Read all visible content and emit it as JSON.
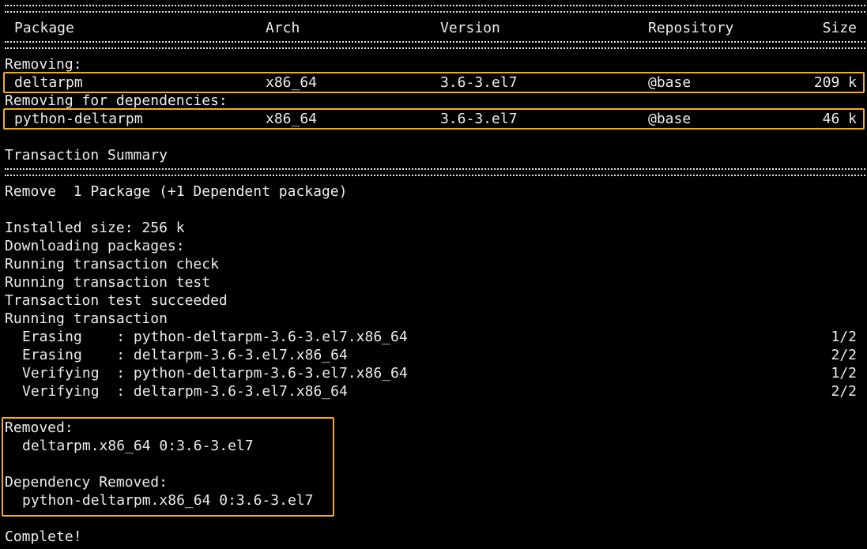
{
  "table": {
    "headers": {
      "package": "Package",
      "arch": "Arch",
      "version": "Version",
      "repository": "Repository",
      "size": "Size"
    },
    "removing_label": "Removing:",
    "removing_deps_label": "Removing for dependencies:",
    "rows": [
      {
        "package": "deltarpm",
        "arch": "x86_64",
        "version": "3.6-3.el7",
        "repository": "@base",
        "size": "209 k"
      },
      {
        "package": "python-deltarpm",
        "arch": "x86_64",
        "version": "3.6-3.el7",
        "repository": "@base",
        "size": "46 k"
      }
    ]
  },
  "summary": {
    "title": "Transaction Summary",
    "remove_line": "Remove  1 Package (+1 Dependent package)",
    "installed_size": "Installed size: 256 k",
    "downloading": "Downloading packages:",
    "check": "Running transaction check",
    "test": "Running transaction test",
    "test_ok": "Transaction test succeeded",
    "running": "Running transaction"
  },
  "steps": [
    {
      "action": "Erasing    : python-deltarpm-3.6-3.el7.x86_64",
      "progress": "1/2"
    },
    {
      "action": "Erasing    : deltarpm-3.6-3.el7.x86_64",
      "progress": "2/2"
    },
    {
      "action": "Verifying  : python-deltarpm-3.6-3.el7.x86_64",
      "progress": "1/2"
    },
    {
      "action": "Verifying  : deltarpm-3.6-3.el7.x86_64",
      "progress": "2/2"
    }
  ],
  "result": {
    "removed_label": "Removed:",
    "removed_pkg": "deltarpm.x86_64 0:3.6-3.el7",
    "dep_removed_label": "Dependency Removed:",
    "dep_removed_pkg": "python-deltarpm.x86_64 0:3.6-3.el7",
    "complete": "Complete!"
  },
  "colors": {
    "background": "#000000",
    "text": "#ececec",
    "highlight": "#f2ad1c"
  }
}
